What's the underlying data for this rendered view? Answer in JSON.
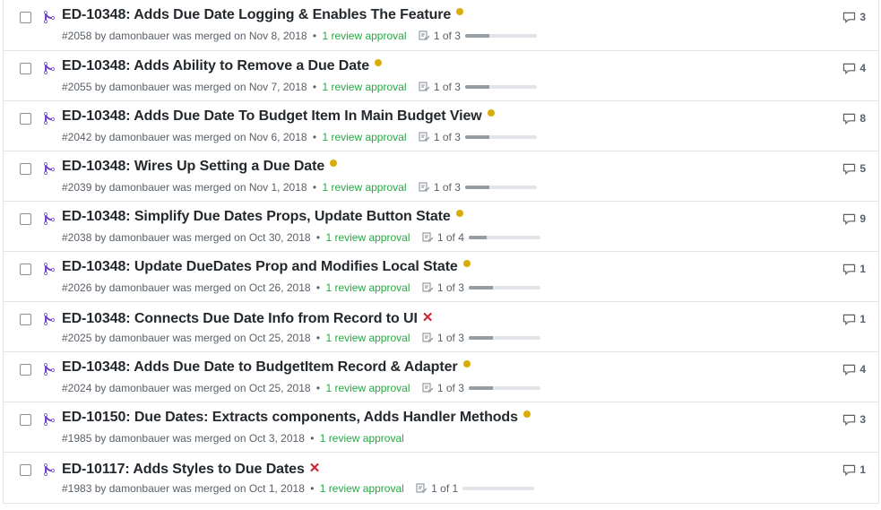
{
  "colors": {
    "pending": "#dbab09",
    "failure": "#cb2431",
    "review": "#28a745",
    "merged": "#6f42c1"
  },
  "pull_requests": [
    {
      "title": "ED-10348: Adds Due Date Logging & Enables The Feature",
      "status": "pending",
      "number": "#2058",
      "author": "damonbauer",
      "merged_text": "was merged on Nov 8, 2018",
      "review": "1 review approval",
      "tasks": "1 of 3",
      "task_progress": 0.333,
      "comments": "3"
    },
    {
      "title": "ED-10348: Adds Ability to Remove a Due Date",
      "status": "pending",
      "number": "#2055",
      "author": "damonbauer",
      "merged_text": "was merged on Nov 7, 2018",
      "review": "1 review approval",
      "tasks": "1 of 3",
      "task_progress": 0.333,
      "comments": "4"
    },
    {
      "title": "ED-10348: Adds Due Date To Budget Item In Main Budget View",
      "status": "pending",
      "number": "#2042",
      "author": "damonbauer",
      "merged_text": "was merged on Nov 6, 2018",
      "review": "1 review approval",
      "tasks": "1 of 3",
      "task_progress": 0.333,
      "comments": "8"
    },
    {
      "title": "ED-10348: Wires Up Setting a Due Date",
      "status": "pending",
      "number": "#2039",
      "author": "damonbauer",
      "merged_text": "was merged on Nov 1, 2018",
      "review": "1 review approval",
      "tasks": "1 of 3",
      "task_progress": 0.333,
      "comments": "5"
    },
    {
      "title": "ED-10348: Simplify Due Dates Props, Update Button State",
      "status": "pending",
      "number": "#2038",
      "author": "damonbauer",
      "merged_text": "was merged on Oct 30, 2018",
      "review": "1 review approval",
      "tasks": "1 of 4",
      "task_progress": 0.25,
      "comments": "9"
    },
    {
      "title": "ED-10348: Update DueDates Prop and Modifies Local State",
      "status": "pending",
      "number": "#2026",
      "author": "damonbauer",
      "merged_text": "was merged on Oct 26, 2018",
      "review": "1 review approval",
      "tasks": "1 of 3",
      "task_progress": 0.333,
      "comments": "1"
    },
    {
      "title": "ED-10348: Connects Due Date Info from Record to UI",
      "status": "failure",
      "number": "#2025",
      "author": "damonbauer",
      "merged_text": "was merged on Oct 25, 2018",
      "review": "1 review approval",
      "tasks": "1 of 3",
      "task_progress": 0.333,
      "comments": "1"
    },
    {
      "title": "ED-10348: Adds Due Date to BudgetItem Record & Adapter",
      "status": "pending",
      "number": "#2024",
      "author": "damonbauer",
      "merged_text": "was merged on Oct 25, 2018",
      "review": "1 review approval",
      "tasks": "1 of 3",
      "task_progress": 0.333,
      "comments": "4"
    },
    {
      "title": "ED-10150: Due Dates: Extracts components, Adds Handler Methods",
      "status": "pending",
      "number": "#1985",
      "author": "damonbauer",
      "merged_text": "was merged on Oct 3, 2018",
      "review": "1 review approval",
      "tasks": null,
      "task_progress": null,
      "comments": "3"
    },
    {
      "title": "ED-10117: Adds Styles to Due Dates",
      "status": "failure",
      "number": "#1983",
      "author": "damonbauer",
      "merged_text": "was merged on Oct 1, 2018",
      "review": "1 review approval",
      "tasks": "1 of 1",
      "task_progress": 0.0,
      "comments": "1"
    }
  ]
}
